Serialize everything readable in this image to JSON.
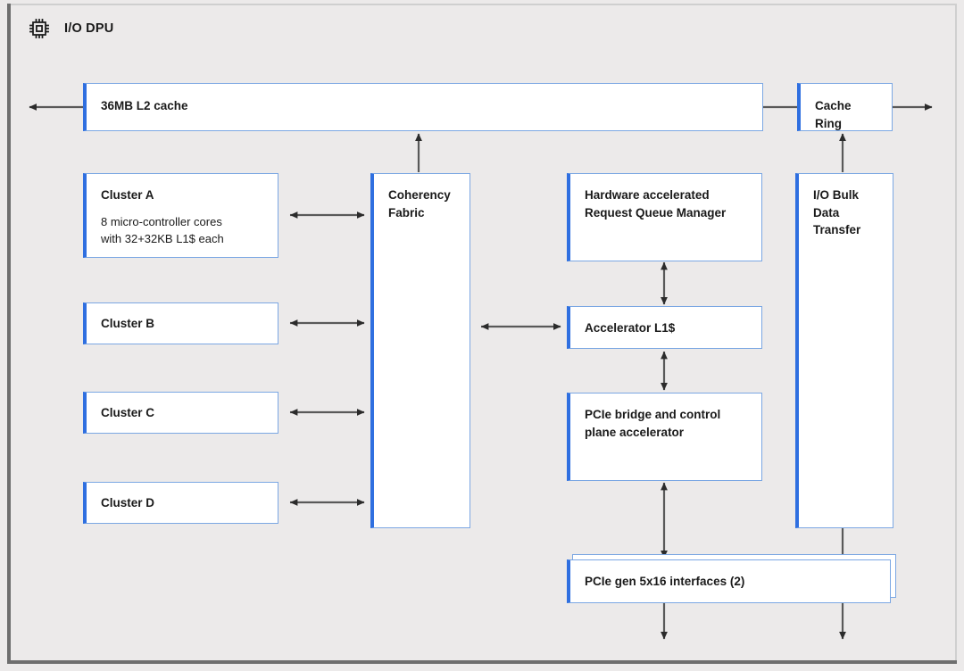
{
  "header": {
    "title": "I/O DPU",
    "icon": "chip-icon"
  },
  "colors": {
    "background": "#eceaea",
    "node_fill": "#ffffff",
    "node_border": "#7ba7e3",
    "node_accent": "#2f6fe0",
    "frame": "#6e6e6e",
    "connector": "#595959",
    "text": "#1a1a1a"
  },
  "nodes": {
    "l2_cache": {
      "title": "36MB L2 cache"
    },
    "cache_ring": {
      "title": "Cache Ring"
    },
    "cluster_a": {
      "title": "Cluster A",
      "detail": "8 micro-controller cores\nwith 32+32KB L1$ each"
    },
    "cluster_b": {
      "title": "Cluster B"
    },
    "cluster_c": {
      "title": "Cluster C"
    },
    "cluster_d": {
      "title": "Cluster D"
    },
    "coherency_fabric": {
      "title": "Coherency\nFabric"
    },
    "request_queue_manager": {
      "title": "Hardware accelerated\nRequest Queue Manager"
    },
    "accelerator_l1": {
      "title": "Accelerator L1$"
    },
    "pcie_bridge": {
      "title": "PCIe bridge and control\nplane accelerator"
    },
    "pcie_interfaces": {
      "title": "PCIe gen 5x16 interfaces (2)"
    },
    "io_bulk_data_transfer": {
      "title": "I/O Bulk\nData\nTransfer"
    }
  },
  "connectors": [
    {
      "name": "l2-cache-to-external-left",
      "type": "arrow-left"
    },
    {
      "name": "l2-cache-to-cache-ring",
      "type": "line"
    },
    {
      "name": "cache-ring-to-external-right",
      "type": "arrow-right"
    },
    {
      "name": "coherency-fabric-to-l2-cache",
      "type": "arrow-up"
    },
    {
      "name": "cache-ring-to-io-bulk",
      "type": "arrow-up"
    },
    {
      "name": "cluster-a-to-coherency-fabric",
      "type": "arrow-both"
    },
    {
      "name": "cluster-b-to-coherency-fabric",
      "type": "arrow-both"
    },
    {
      "name": "cluster-c-to-coherency-fabric",
      "type": "arrow-both"
    },
    {
      "name": "cluster-d-to-coherency-fabric",
      "type": "arrow-both"
    },
    {
      "name": "coherency-fabric-to-accelerator-l1",
      "type": "arrow-both"
    },
    {
      "name": "request-queue-manager-to-accelerator-l1",
      "type": "arrow-both"
    },
    {
      "name": "accelerator-l1-to-pcie-bridge",
      "type": "arrow-both"
    },
    {
      "name": "pcie-bridge-to-pcie-interfaces",
      "type": "arrow-both"
    },
    {
      "name": "io-bulk-to-pcie-interfaces",
      "type": "line"
    },
    {
      "name": "pcie-interfaces-out-left",
      "type": "arrow-down"
    },
    {
      "name": "pcie-interfaces-out-right",
      "type": "arrow-down"
    }
  ]
}
